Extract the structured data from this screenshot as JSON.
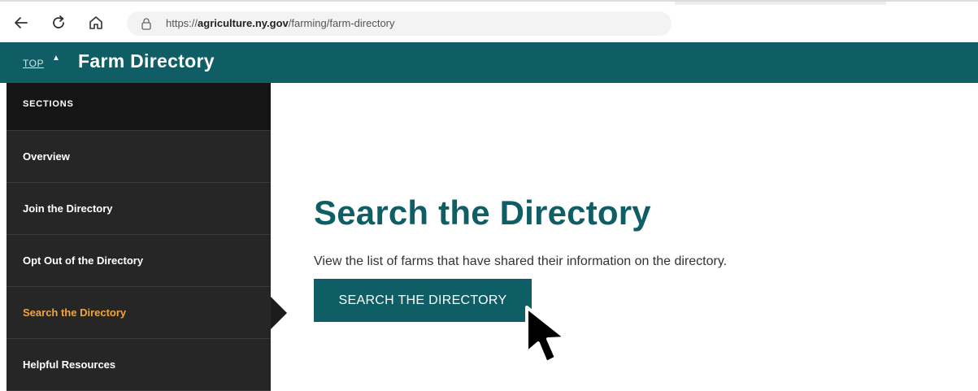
{
  "browser": {
    "url_prefix": "https://",
    "url_domain": "agriculture.ny.gov",
    "url_path": "/farming/farm-directory",
    "back_icon": "arrow-left-icon",
    "refresh_icon": "refresh-icon",
    "home_icon": "home-icon",
    "lock_icon": "lock-icon"
  },
  "header": {
    "top_link": "TOP",
    "top_caret": "▲",
    "title": "Farm Directory",
    "background_color": "#0f5e66"
  },
  "sidebar": {
    "heading": "SECTIONS",
    "items": [
      {
        "label": "Overview",
        "active": false
      },
      {
        "label": "Join the Directory",
        "active": false
      },
      {
        "label": "Opt Out of the Directory",
        "active": false
      },
      {
        "label": "Search the Directory",
        "active": true
      },
      {
        "label": "Helpful Resources",
        "active": false
      }
    ],
    "active_color": "#f0a63c"
  },
  "main": {
    "title": "Search the Directory",
    "description": "View the list of farms that have shared their information on the directory.",
    "button_label": "SEARCH THE DIRECTORY"
  },
  "overlay": {
    "cursor_icon": "mouse-pointer-icon"
  }
}
